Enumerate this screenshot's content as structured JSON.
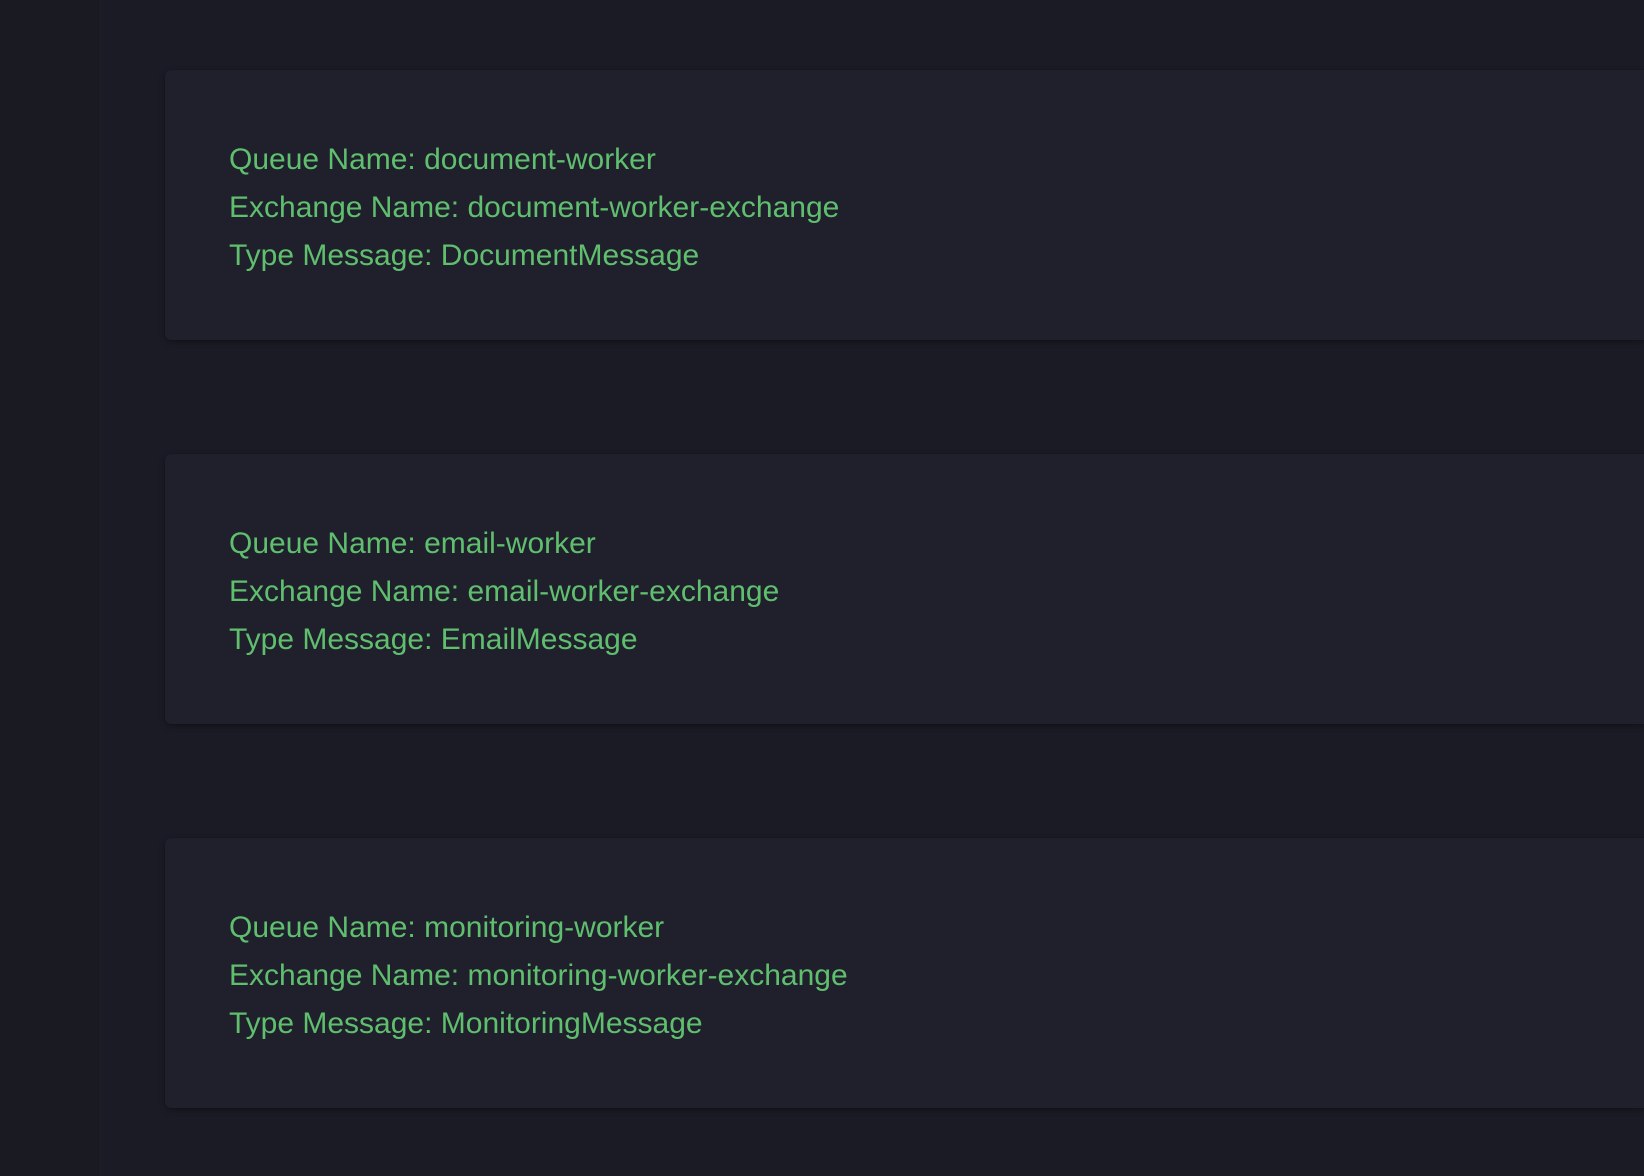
{
  "queues": [
    {
      "queue_line": "Queue Name: document-worker",
      "exchange_line": "Exchange Name: document-worker-exchange",
      "type_line": "Type Message: DocumentMessage"
    },
    {
      "queue_line": "Queue Name: email-worker",
      "exchange_line": "Exchange Name: email-worker-exchange",
      "type_line": "Type Message: EmailMessage"
    },
    {
      "queue_line": "Queue Name: monitoring-worker",
      "exchange_line": "Exchange Name: monitoring-worker-exchange",
      "type_line": "Type Message: MonitoringMessage"
    }
  ],
  "colors": {
    "background": "#1b1b25",
    "card": "#20202d",
    "text": "#5fbf6e"
  }
}
